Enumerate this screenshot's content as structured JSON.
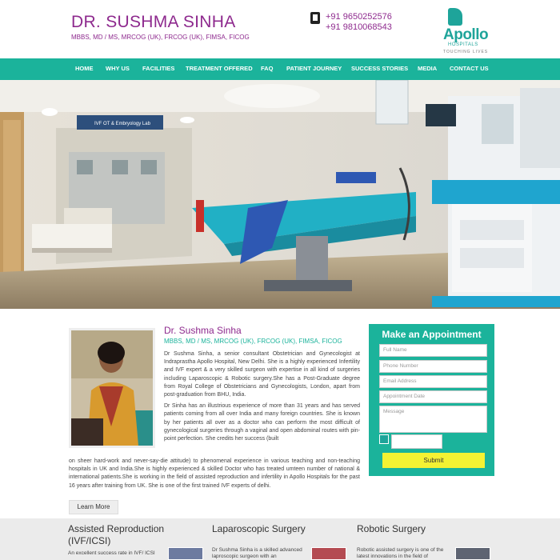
{
  "header": {
    "doctor_name": "DR. SUSHMA SINHA",
    "qualifications": "MBBS, MD / MS, MRCOG (UK), FRCOG (UK), FIMSA, FICOG",
    "phone1": "+91 9650252576",
    "phone2": "+91 9810068543",
    "logo": {
      "name": "Apollo",
      "sub": "HOSPITALS",
      "tagline": "TOUCHING LIVES"
    }
  },
  "nav": {
    "items": [
      "HOME",
      "WHY US",
      "FACILITIES",
      "TREATMENT OFFERED",
      "FAQ",
      "PATIENT JOURNEY",
      "SUCCESS STORIES",
      "MEDIA",
      "CONTACT US"
    ]
  },
  "hero": {
    "sign_text": "IVF OT & Embryology Lab"
  },
  "profile": {
    "name": "Dr. Sushma Sinha",
    "qualifications": "MBBS, MD / MS, MRCOG (UK), FRCOG (UK), FIMSA, FICOG",
    "bio_p1": "Dr Sushma Sinha, a senior consultant Obstetrician and Gynecologist at Indraprastha Apollo Hospital, New Delhi. She is a highly experienced Infertility and IVF expert & a very skilled surgeon with expertise in all kind of surgeries including Laparoscopic & Robotic surgery.She has a Post-Graduate degree from Royal College of Obstetricians and Gynecologists, London, apart from post-graduation from BHU, India.",
    "bio_p2a": "Dr Sinha has an illustrious experience of more than 31 years and has served patients coming from all over India and many foreign countries. She is known by her patients all over as a doctor who can perform the most difficult of gynecological surgeries through a vaginal and open abdominal routes with pin-point perfection. She credits her success (built",
    "bio_p2b": "on sheer hard-work and never-say-die attitude) to phenomenal experience in various teaching and non-teaching hospitals in UK and India.She is highly experienced & skilled Doctor who has treated umteen number of national & international patients.She is working in the field of assisted reproduction and infertility in Apollo Hospitals for the past 16 years after training from UK. She is one of the first trained IVF experts of delhi.",
    "learn_more": "Learn More"
  },
  "appointment": {
    "title": "Make an Appointment",
    "placeholders": {
      "name": "Full Name",
      "phone": "Phone Number",
      "email": "Email Address",
      "date": "Appointment Date",
      "message": "Message"
    },
    "submit": "Submit"
  },
  "services": [
    {
      "title_line1": "Assisted Reproduction",
      "title_line2": "(IVF/ICSI)",
      "text": "An excellent success rate in IVF/ ICSI"
    },
    {
      "title_line1": "Laparoscopic Surgery",
      "title_line2": "",
      "text": "Dr Sushma Sinha is a skilled advanced laproscopic surgeon with an"
    },
    {
      "title_line1": "Robotic Surgery",
      "title_line2": "",
      "text": "Robotic assisted surgery is one of the latest innovations in the field of"
    }
  ],
  "colors": {
    "brand_purple": "#8e2a8e",
    "nav_teal": "#1bb39b",
    "submit_yellow": "#f4f233"
  }
}
